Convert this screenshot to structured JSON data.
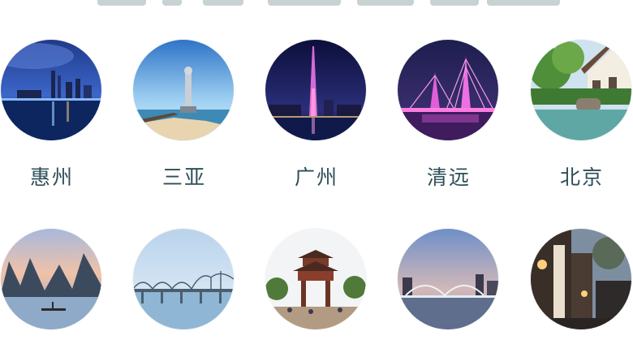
{
  "cities": [
    {
      "name": "惠州",
      "image": "huizhou-night-bay-skyline"
    },
    {
      "name": "三亚",
      "image": "sanya-guanyin-statue-sea"
    },
    {
      "name": "广州",
      "image": "guangzhou-canton-tower-night"
    },
    {
      "name": "清远",
      "image": "qingyuan-lit-cable-bridge"
    },
    {
      "name": "北京",
      "image": "beijing-garden-pond"
    },
    {
      "name": "",
      "image": "guilin-karst-river-raft"
    },
    {
      "name": "",
      "image": "dandong-yalu-river-bridge"
    },
    {
      "name": "",
      "image": "chinese-pagoda-gate"
    },
    {
      "name": "",
      "image": "river-arch-bridge-city"
    },
    {
      "name": "",
      "image": "old-town-street-evening"
    }
  ]
}
